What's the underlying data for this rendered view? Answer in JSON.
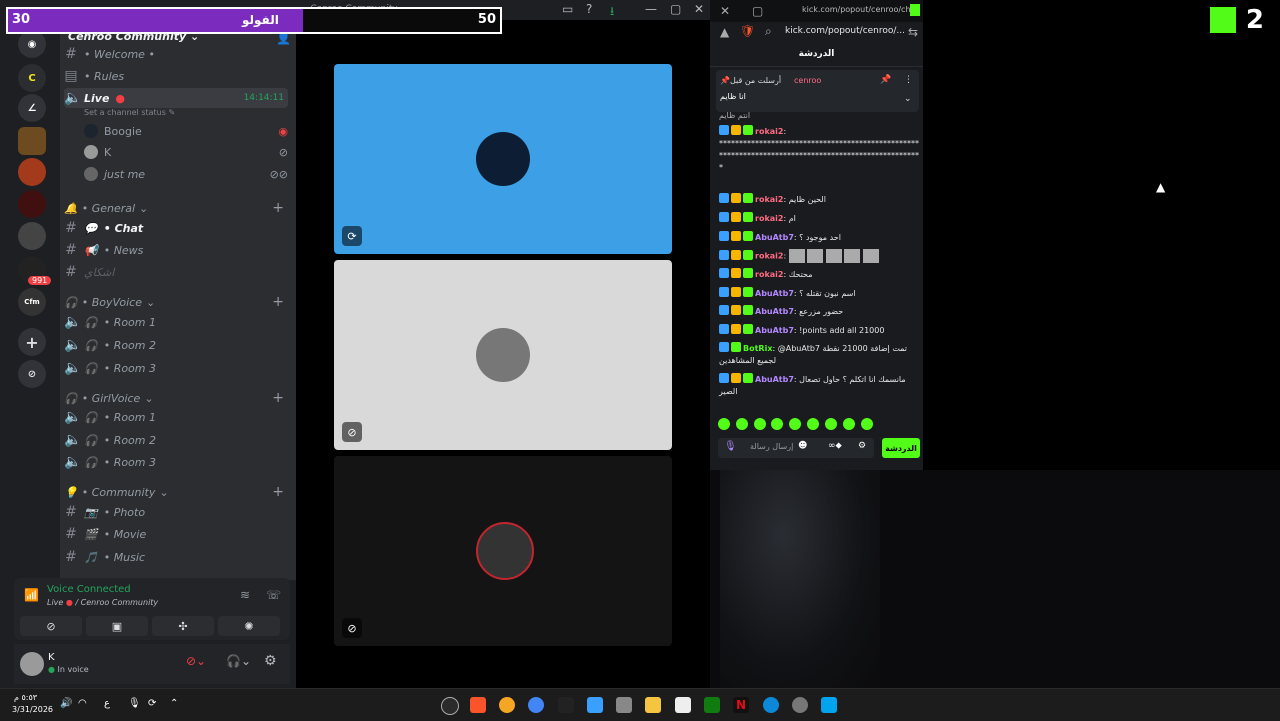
{
  "overlay": {
    "left_count": "30",
    "label": "الفولو",
    "right_count": "50",
    "progress": 0.6
  },
  "discord": {
    "server_name": "Cenroo Community",
    "title_bar_text": "Cenroo Community",
    "welcome": "• Welcome •",
    "rules": "• Rules",
    "live_channel": "Live",
    "live_timer": "14:14:11",
    "channel_status_hint": "Set a channel status",
    "voice_users": [
      {
        "name": "Boogie"
      },
      {
        "name": "K"
      },
      {
        "name": "just me"
      }
    ],
    "general_category": "• General",
    "chat_channel": "• Chat",
    "news_channel": "• News",
    "arabic_channel": "اشكاي",
    "boy_voice_category": "• BoyVoice",
    "girl_voice_category": "• GirlVoice",
    "rooms": [
      "• Room 1",
      "• Room 2",
      "• Room 3"
    ],
    "community_category": "• Community",
    "community_channels": [
      "• Photo",
      "• Movie",
      "• Music"
    ],
    "server_badges": {
      "badge1": "991"
    },
    "server_labels": {
      "cfm": "Cfm"
    },
    "voice_connected": "Voice Connected",
    "voice_location": "Live",
    "voice_server": "/ Cenroo Community",
    "user_name": "K",
    "user_status": "In voice"
  },
  "browser": {
    "url": "kick.com/popout/cenroo/ch...",
    "address": "kick.com/popout/cenroo/..."
  },
  "kick_chat": {
    "header": "الدردشة",
    "pinned_by": "أرسلت من قبل",
    "pinned_user": "cenroo",
    "pinned_text": "انا ظايم",
    "cut_line": "انتم ظايم",
    "messages": [
      {
        "user": "rokai2",
        "color": "#ff6b81",
        "text": "*****************************************************************************************************"
      },
      {
        "user": "rokai2",
        "color": "#ff6b81",
        "text": "الحين ظايم"
      },
      {
        "user": "rokai2",
        "color": "#ff6b81",
        "text": "ام"
      },
      {
        "user": "AbuAtb7",
        "color": "#b388ff",
        "text": "احد موجود ؟"
      },
      {
        "user": "rokai2",
        "color": "#ff6b81",
        "text": "[emotes]"
      },
      {
        "user": "rokai2",
        "color": "#ff6b81",
        "text": "محتحك"
      },
      {
        "user": "AbuAtb7",
        "color": "#b388ff",
        "text": "اسم نبون تقتله ؟"
      },
      {
        "user": "AbuAtb7",
        "color": "#b388ff",
        "text": "حضور مزرعع"
      },
      {
        "user": "AbuAtb7",
        "color": "#b388ff",
        "text": "!points add all 21000"
      },
      {
        "user": "BotRix",
        "color": "#53fc18",
        "text": "@AbuAtb7 تمت إضافة 21000 نقطة لجميع المشاهدين"
      },
      {
        "user": "AbuAtb7",
        "color": "#b388ff",
        "text": "مانسمك انا اتكلم ؟ حاول تصعال الصير"
      }
    ],
    "input_placeholder": "إرسال رسالة",
    "send_label": "الدردشة"
  },
  "kick_overlay": {
    "number": "2"
  },
  "taskbar": {
    "time": "٥:٥٣ م",
    "date": "3/31/2026",
    "lang": "ع"
  }
}
